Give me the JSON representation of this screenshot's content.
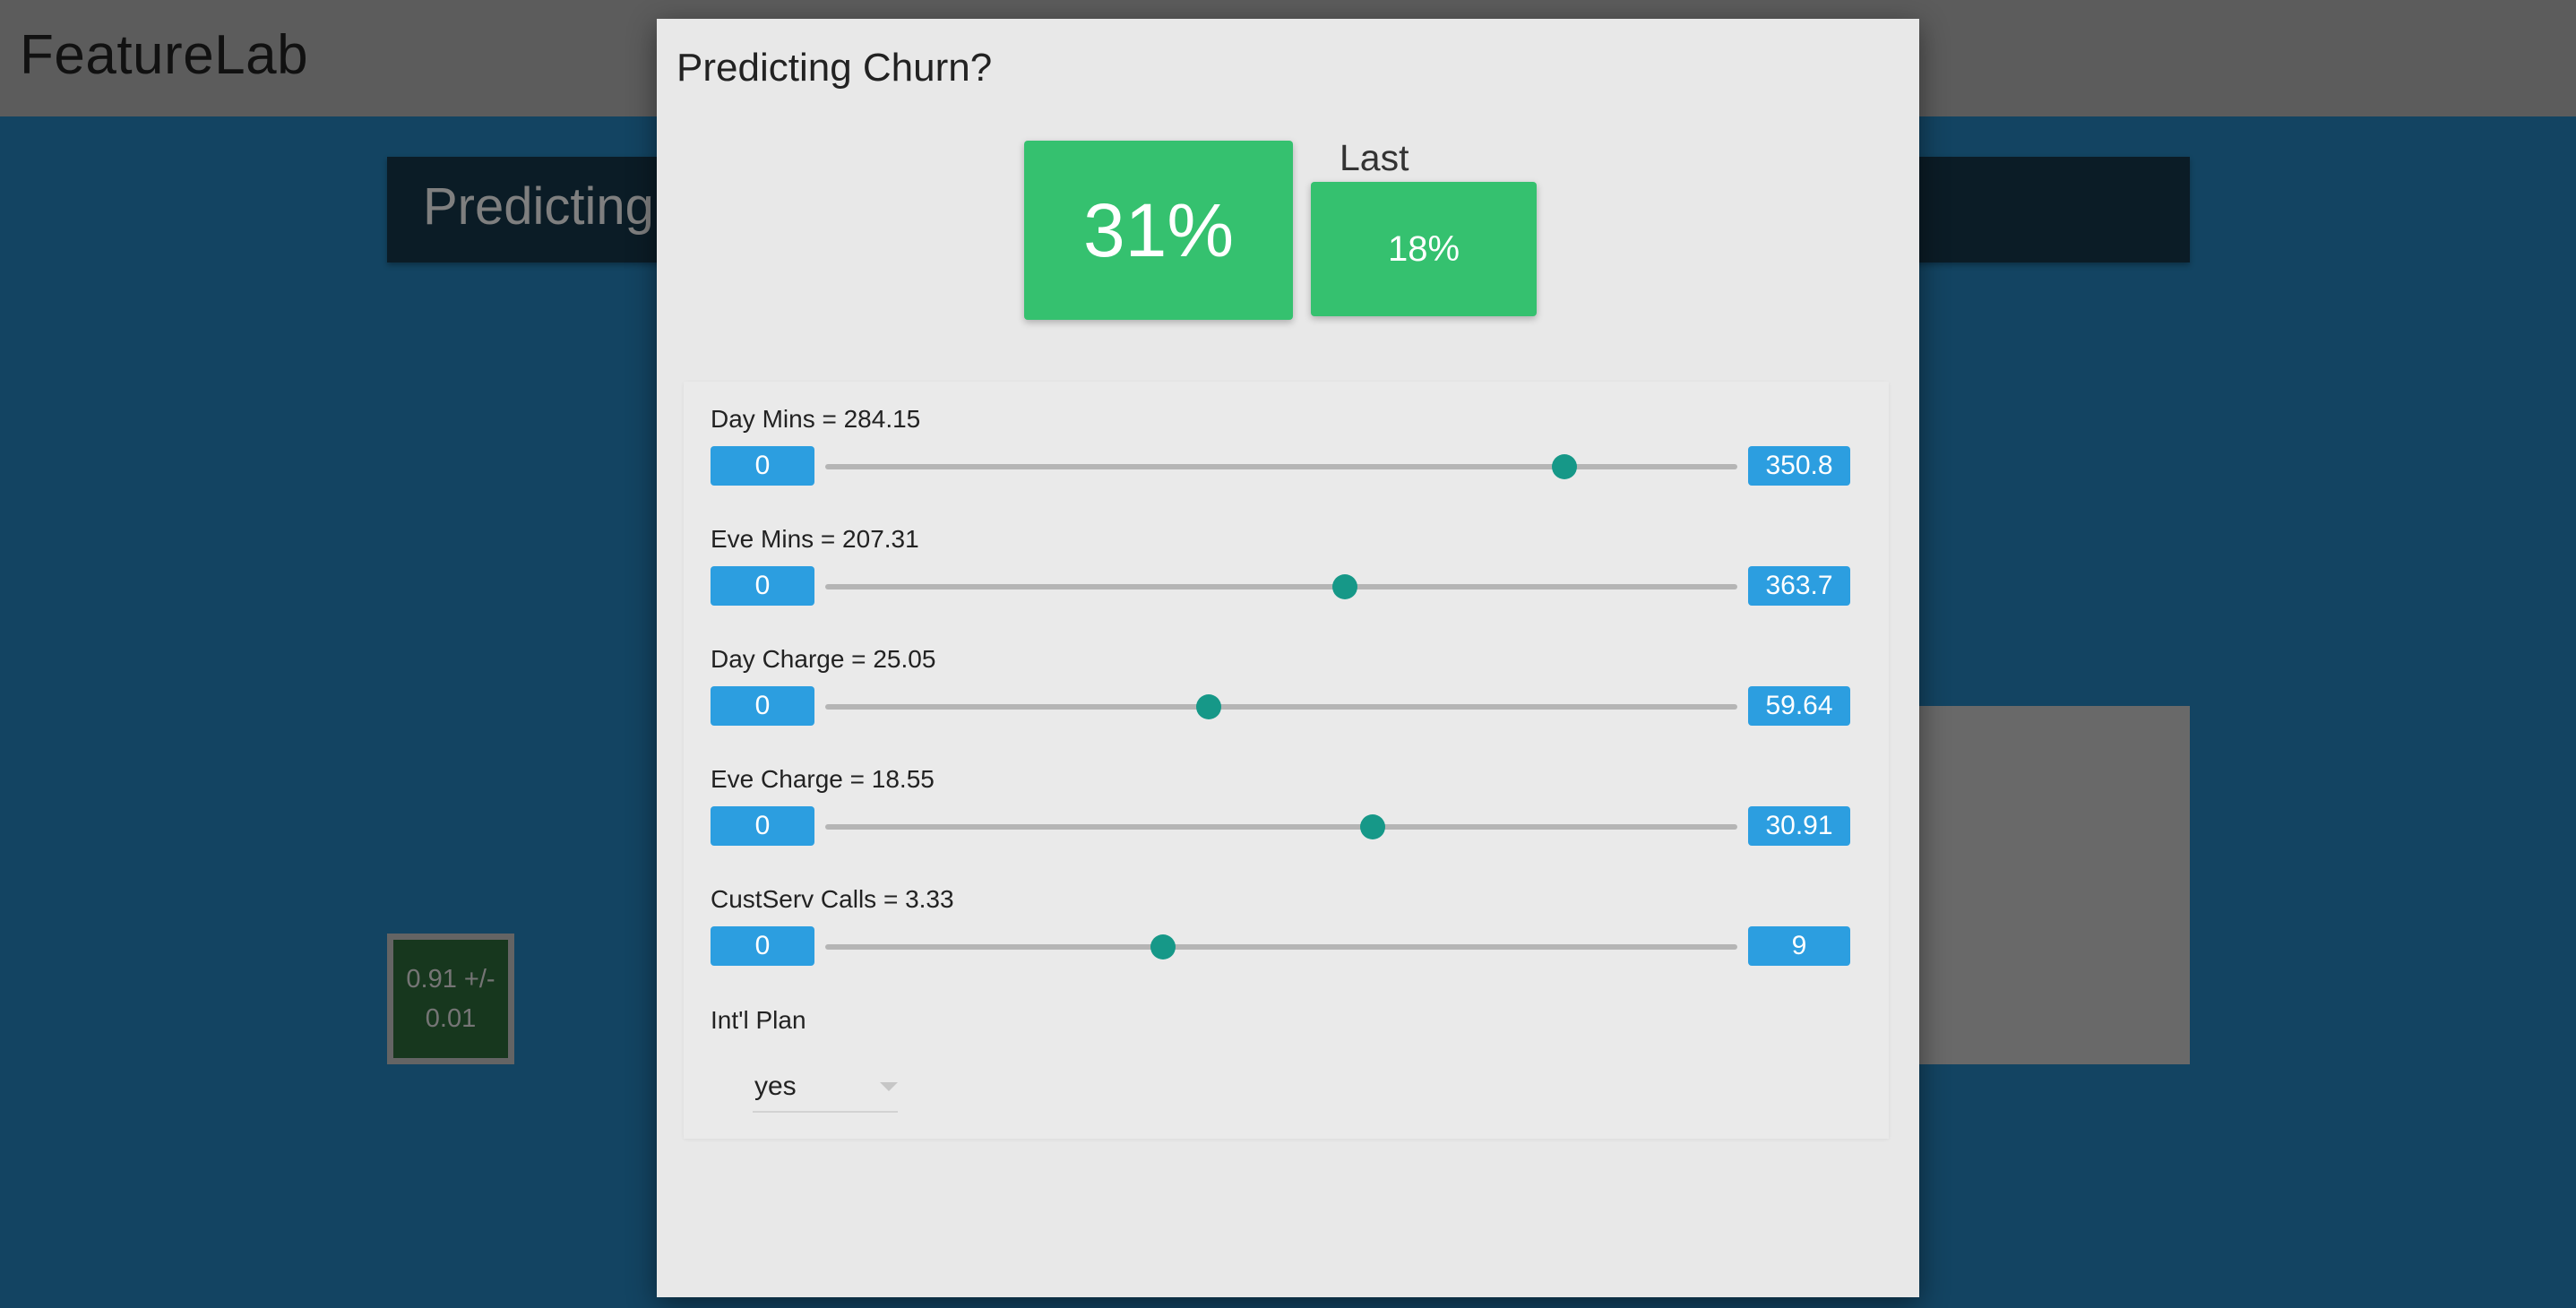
{
  "app": {
    "title": "FeatureLab",
    "banner_text": "Predicting",
    "score_line1": "0.91 +/-",
    "score_line2": "0.01"
  },
  "modal": {
    "title": "Predicting Churn?",
    "current_prediction": "31%",
    "last_label": "Last",
    "last_prediction": "18%",
    "sliders": [
      {
        "label": "Day Mins = 284.15",
        "min": "0",
        "max": "350.8",
        "value": 284.15
      },
      {
        "label": "Eve Mins = 207.31",
        "min": "0",
        "max": "363.7",
        "value": 207.31
      },
      {
        "label": "Day Charge = 25.05",
        "min": "0",
        "max": "59.64",
        "value": 25.05
      },
      {
        "label": "Eve Charge = 18.55",
        "min": "0",
        "max": "30.91",
        "value": 18.55
      },
      {
        "label": "CustServ Calls = 3.33",
        "min": "0",
        "max": "9",
        "value": 3.33
      }
    ],
    "intl_plan": {
      "label": "Int'l Plan",
      "value": "yes"
    }
  },
  "colors": {
    "prediction_green": "#35c16f",
    "range_blue": "#2c9ee0",
    "slider_thumb": "#169888"
  }
}
